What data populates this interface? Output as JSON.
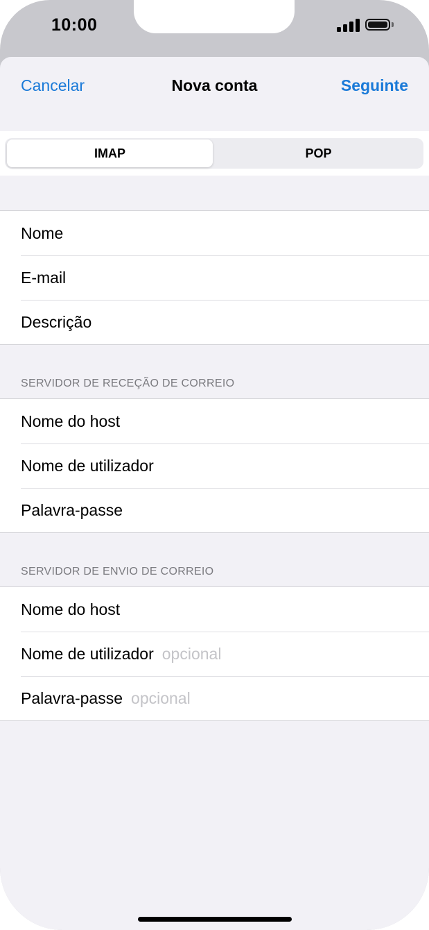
{
  "status": {
    "time": "10:00"
  },
  "nav": {
    "cancel": "Cancelar",
    "title": "Nova conta",
    "next": "Seguinte"
  },
  "segment": {
    "imap": "IMAP",
    "pop": "POP",
    "selected": "IMAP"
  },
  "account": {
    "rows": [
      {
        "label": "Nome"
      },
      {
        "label": "E-mail"
      },
      {
        "label": "Descrição"
      }
    ]
  },
  "incoming": {
    "header": "SERVIDOR DE RECEÇÃO DE CORREIO",
    "rows": [
      {
        "label": "Nome do host"
      },
      {
        "label": "Nome de utilizador"
      },
      {
        "label": "Palavra-passe"
      }
    ]
  },
  "outgoing": {
    "header": "SERVIDOR DE ENVIO DE CORREIO",
    "rows": [
      {
        "label": "Nome do host"
      },
      {
        "label": "Nome de utilizador",
        "hint": "opcional"
      },
      {
        "label": "Palavra-passe",
        "hint": "opcional"
      }
    ]
  },
  "icons": {
    "signal": "cellular-signal-icon",
    "battery": "battery-icon"
  }
}
